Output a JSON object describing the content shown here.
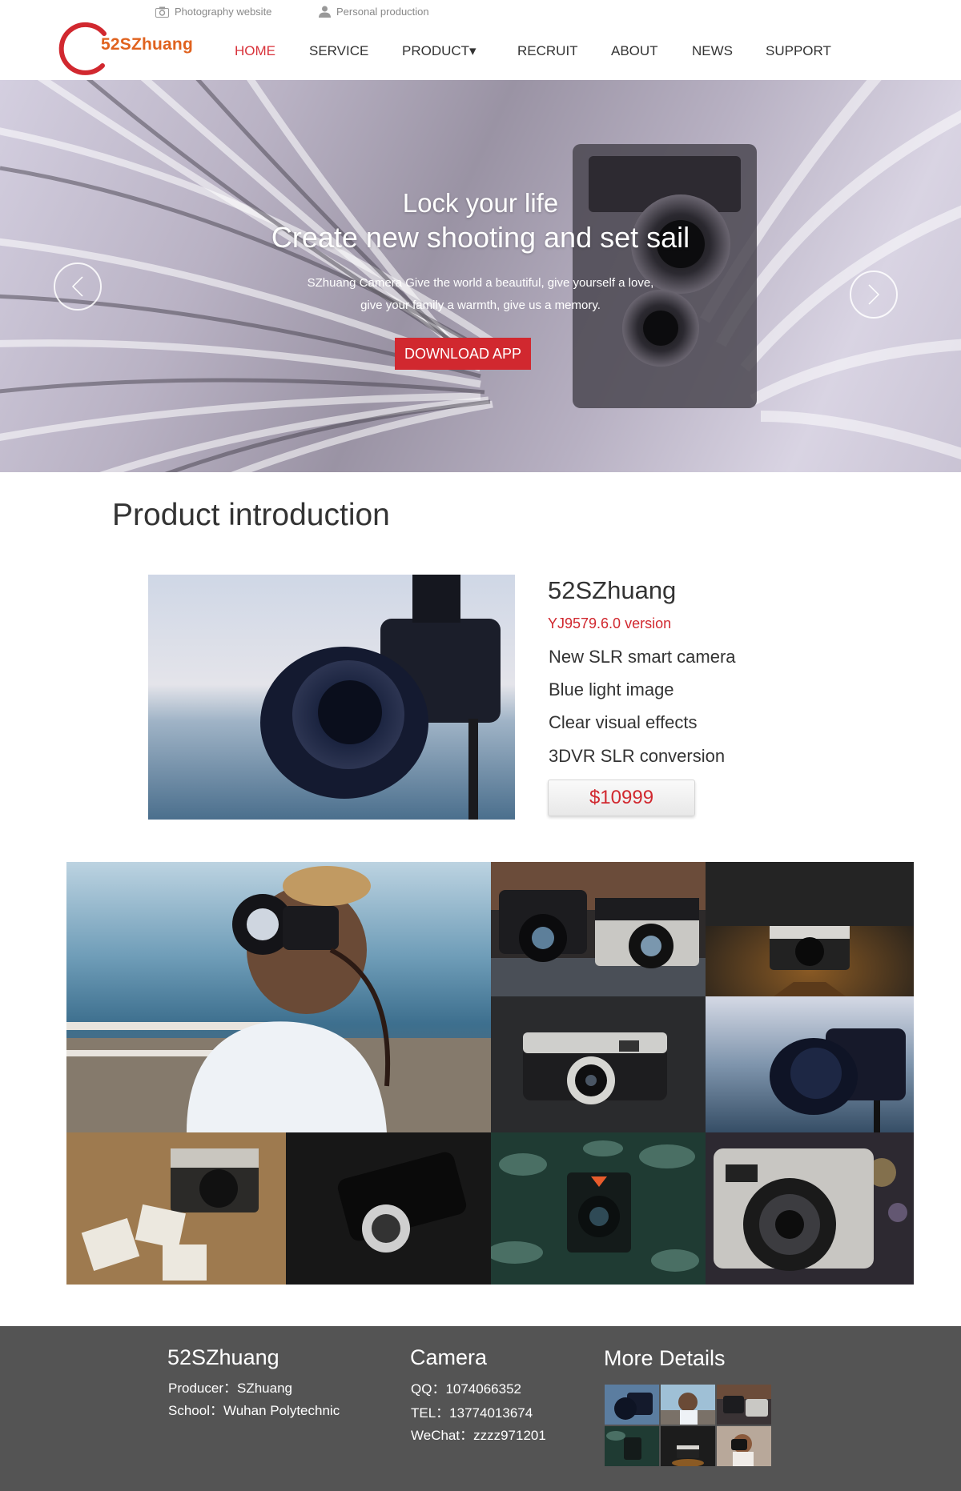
{
  "topbar": {
    "left_label": "Photography website",
    "left_icon": "camera-icon",
    "right_label": "Personal production",
    "right_icon": "user-icon"
  },
  "brand": {
    "logo_text": "52SZhuang",
    "accent": "#d1282f",
    "logo_text_color": "#e0621e"
  },
  "nav": {
    "items": [
      {
        "label": "HOME",
        "active": true
      },
      {
        "label": "SERVICE"
      },
      {
        "label": "PRODUCT▾"
      },
      {
        "label": "RECRUIT"
      },
      {
        "label": "ABOUT"
      },
      {
        "label": "NEWS"
      },
      {
        "label": "SUPPORT"
      }
    ]
  },
  "hero": {
    "title_line1": "Lock your life",
    "title_line2": "Create new shooting and set sail",
    "subtitle_line1": "SZhuang Camera Give the world a beautiful, give yourself a love,",
    "subtitle_line2": "give your family a warmth, give us a memory.",
    "button_label": "DOWNLOAD APP",
    "prev_icon": "chevron-left-icon",
    "next_icon": "chevron-right-icon"
  },
  "product": {
    "section_title": "Product introduction",
    "name": "52SZhuang",
    "version": "YJ9579.6.0 version",
    "features": [
      "New SLR smart camera",
      "Blue light image",
      "Clear visual effects",
      "3DVR SLR conversion"
    ],
    "price": "$10999"
  },
  "footer": {
    "col1": {
      "title": "52SZhuang",
      "lines": [
        "Producer：SZhuang",
        "School：Wuhan Polytechnic"
      ]
    },
    "col2": {
      "title": "Camera",
      "lines": [
        "QQ：1074066352",
        "TEL：13774013674",
        "WeChat：zzzz971201"
      ]
    },
    "col3": {
      "title": "More Details"
    },
    "background": "#545454"
  }
}
